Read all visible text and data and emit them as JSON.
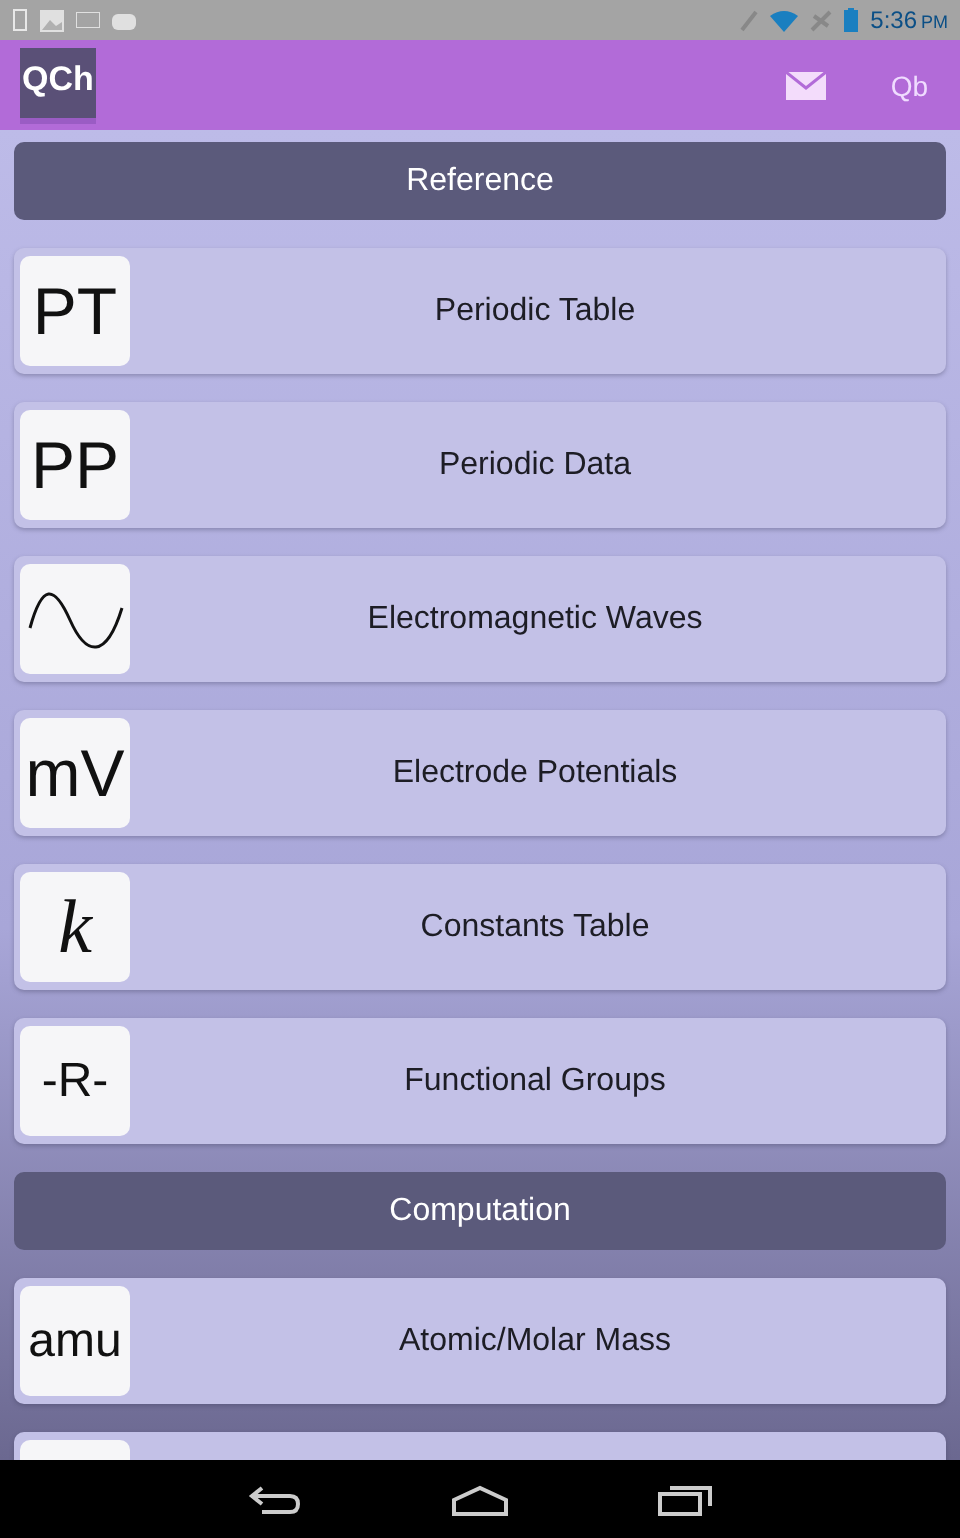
{
  "status_bar": {
    "time": "5:36",
    "ampm": "PM"
  },
  "app_bar": {
    "logo": "QCh",
    "action": "Qb"
  },
  "sections": [
    {
      "title": "Reference",
      "items": [
        {
          "kind": "text",
          "icon": "PT",
          "label": "Periodic Table"
        },
        {
          "kind": "text",
          "icon": "PP",
          "label": "Periodic Data"
        },
        {
          "kind": "wave",
          "label": "Electromagnetic Waves"
        },
        {
          "kind": "text",
          "icon": "mV",
          "label": "Electrode Potentials"
        },
        {
          "kind": "math",
          "icon": "k",
          "label": "Constants Table"
        },
        {
          "kind": "text",
          "icon": "-R-",
          "label": "Functional Groups"
        }
      ]
    },
    {
      "title": "Computation",
      "items": [
        {
          "kind": "text",
          "icon": "amu",
          "label": "Atomic/Molar Mass"
        },
        {
          "kind": "blank"
        }
      ]
    }
  ]
}
